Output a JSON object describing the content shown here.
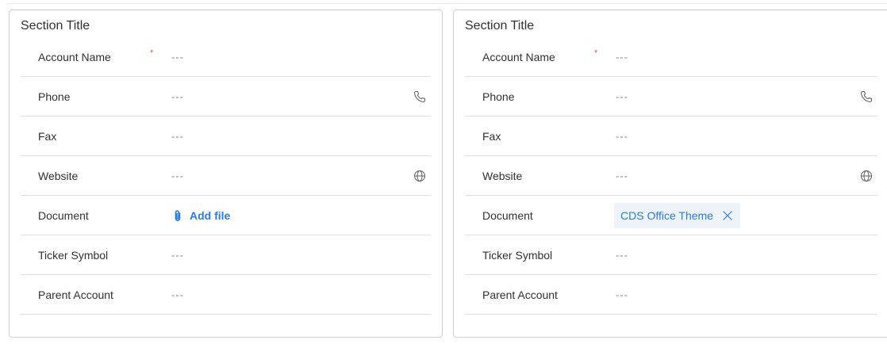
{
  "panels": [
    {
      "title": "Section Title",
      "fields": {
        "account_name": {
          "label": "Account Name",
          "required_mark": "*",
          "value": "---"
        },
        "phone": {
          "label": "Phone",
          "value": "---"
        },
        "fax": {
          "label": "Fax",
          "value": "---"
        },
        "website": {
          "label": "Website",
          "value": "---"
        },
        "document": {
          "label": "Document",
          "add_file_label": "Add file"
        },
        "ticker_symbol": {
          "label": "Ticker Symbol",
          "value": "---"
        },
        "parent_account": {
          "label": "Parent Account",
          "value": "---"
        }
      }
    },
    {
      "title": "Section Title",
      "fields": {
        "account_name": {
          "label": "Account Name",
          "required_mark": "*",
          "value": "---"
        },
        "phone": {
          "label": "Phone",
          "value": "---"
        },
        "fax": {
          "label": "Fax",
          "value": "---"
        },
        "website": {
          "label": "Website",
          "value": "---"
        },
        "document": {
          "label": "Document",
          "file_name": "CDS Office Theme"
        },
        "ticker_symbol": {
          "label": "Ticker Symbol",
          "value": "---"
        },
        "parent_account": {
          "label": "Parent Account",
          "value": "---"
        }
      }
    }
  ],
  "icons": {
    "phone": "phone-icon",
    "website": "globe-icon",
    "attach": "paperclip-icon",
    "remove": "close-icon"
  },
  "colors": {
    "link": "#2b7cd3",
    "required": "#e8504b",
    "chip_background": "#edf3f8",
    "border": "#d2d0ce",
    "divider": "#e1dfdd"
  }
}
